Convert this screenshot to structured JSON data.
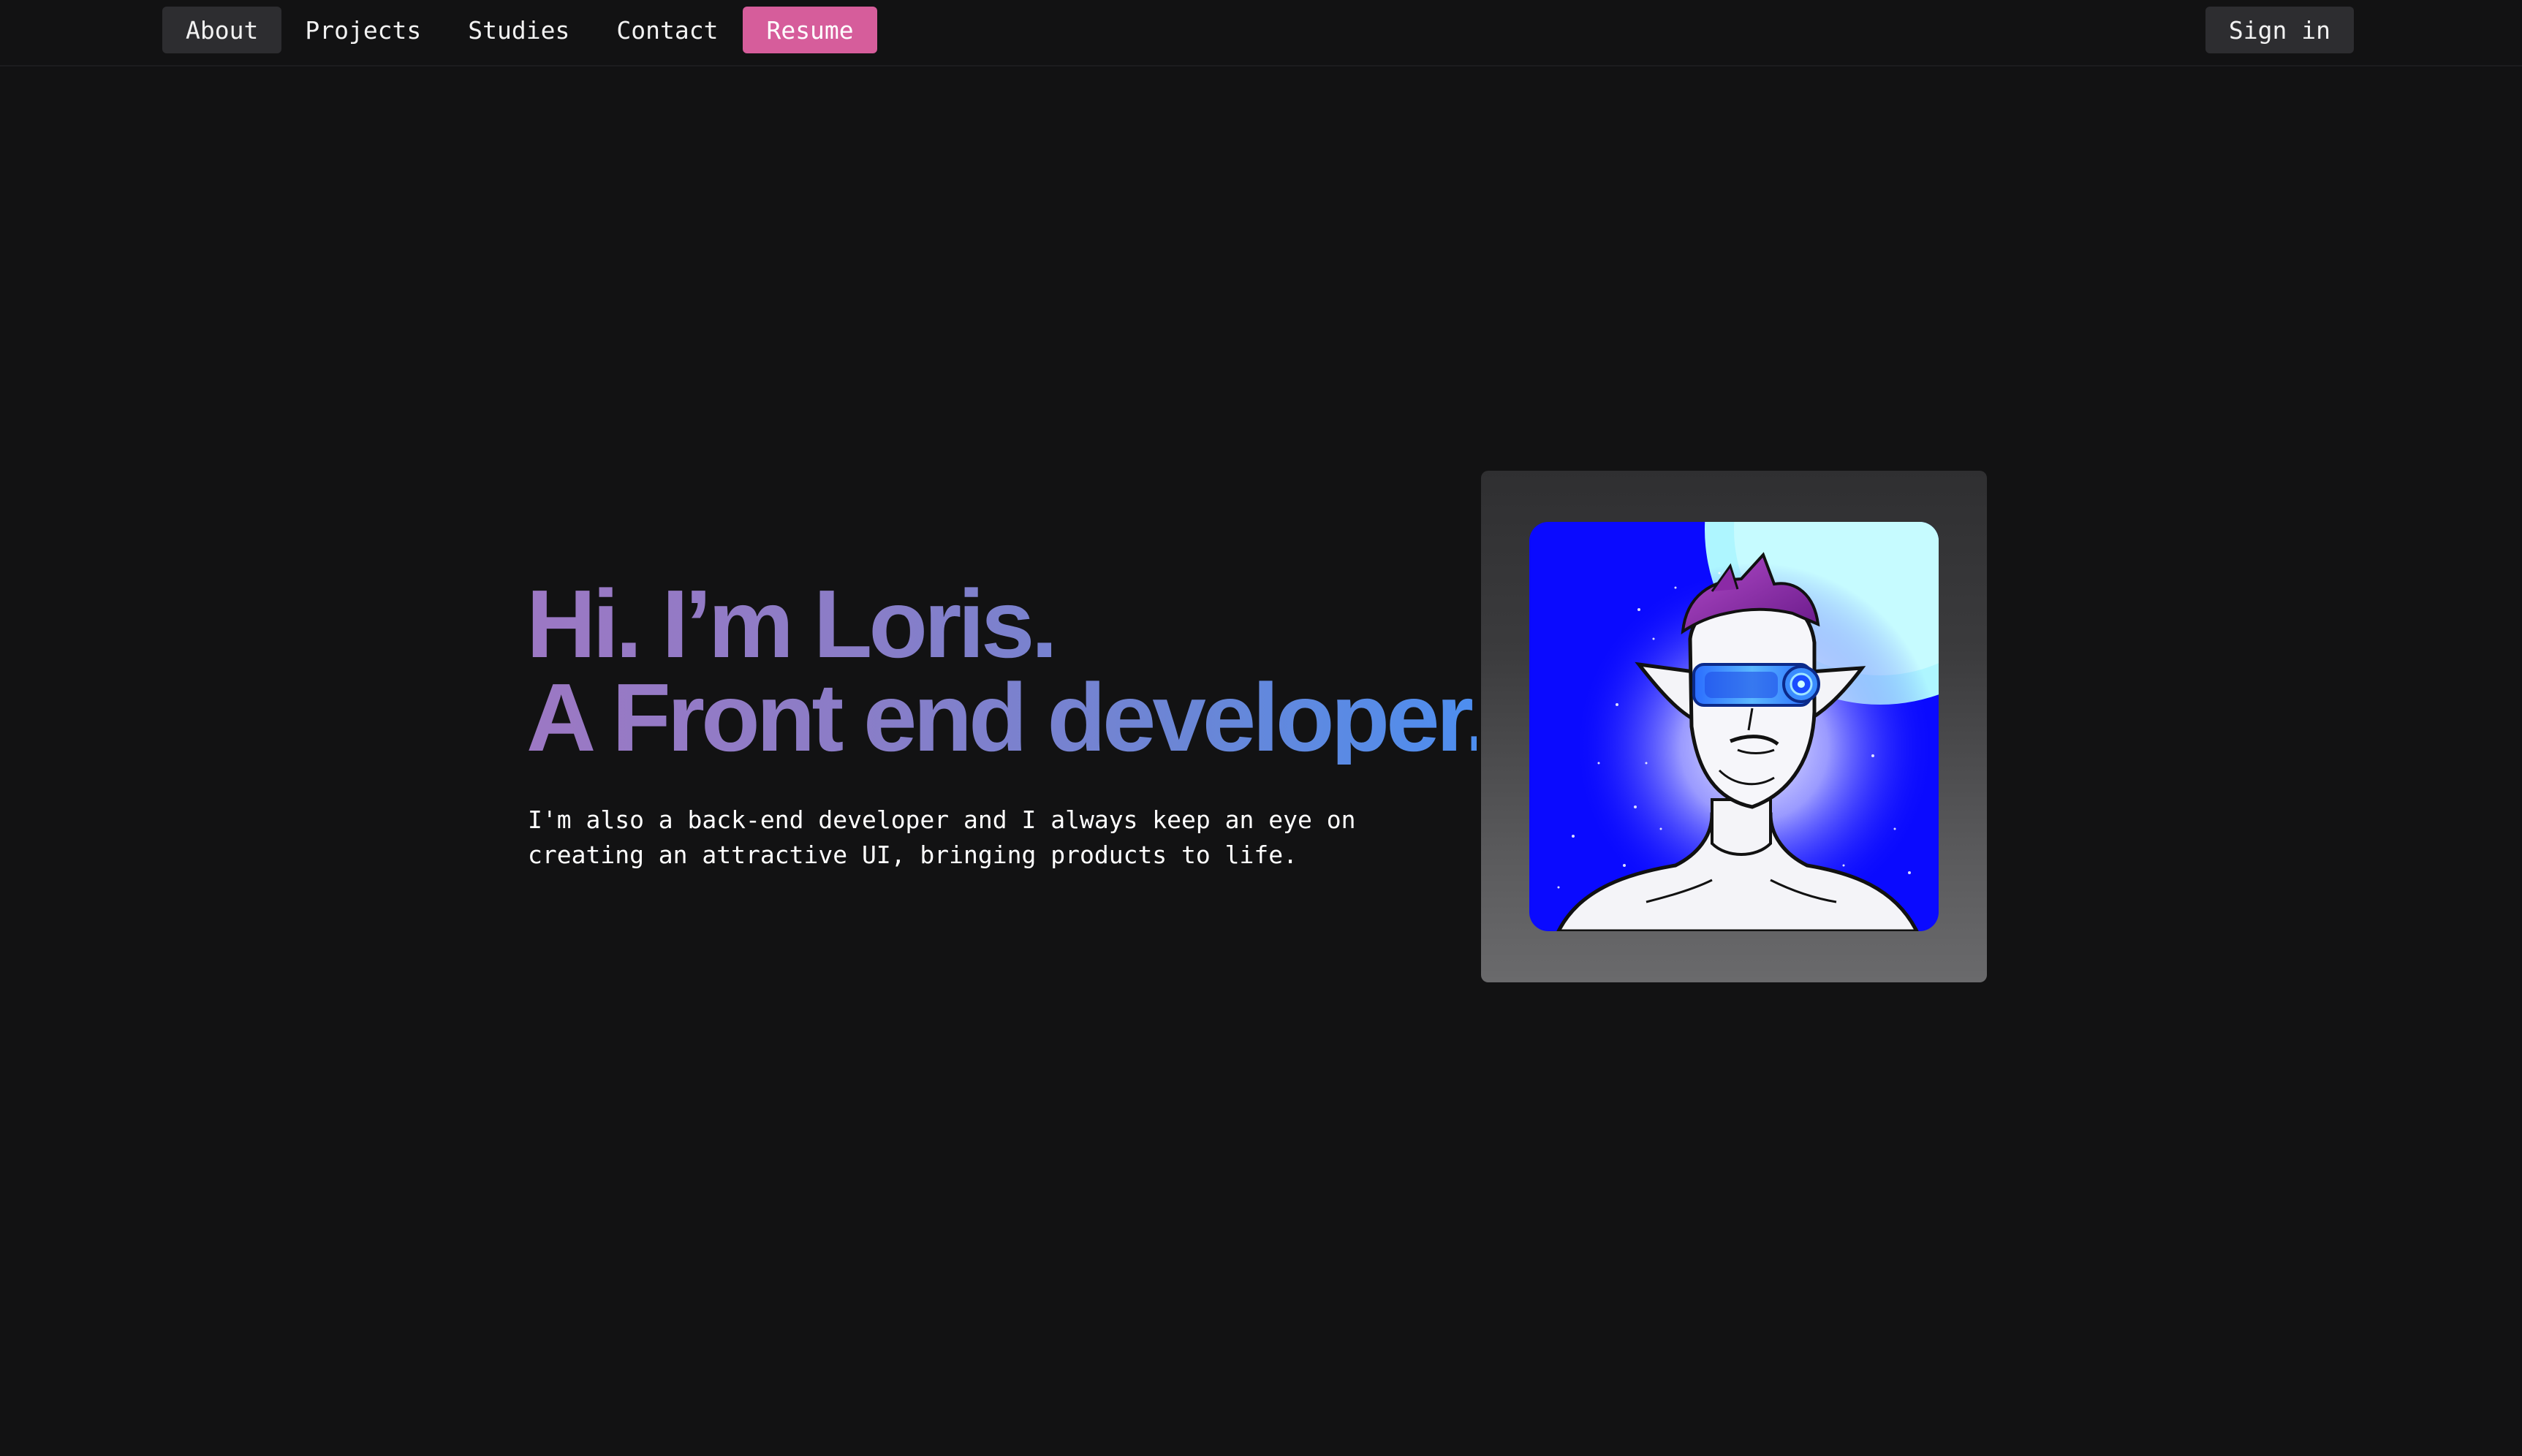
{
  "nav": {
    "items": [
      {
        "label": "About",
        "active": true
      },
      {
        "label": "Projects",
        "active": false
      },
      {
        "label": "Studies",
        "active": false
      },
      {
        "label": "Contact",
        "active": false
      }
    ],
    "resume_label": "Resume",
    "signin_label": "Sign in"
  },
  "hero": {
    "headline_line1": "Hi. I’m Loris.",
    "headline_line2": "A Front end developer.",
    "subtitle": "I'm also a back-end developer and I always keep an eye on creating an attractive UI, bringing products to life."
  },
  "colors": {
    "background": "#121213",
    "nav_active_bg": "#2d2d30",
    "resume_accent": "#d65d9b",
    "headline_gradient_start": "#9c78c4",
    "headline_gradient_end": "#4d8ef0",
    "avatar_bg": "#0a0aff"
  }
}
